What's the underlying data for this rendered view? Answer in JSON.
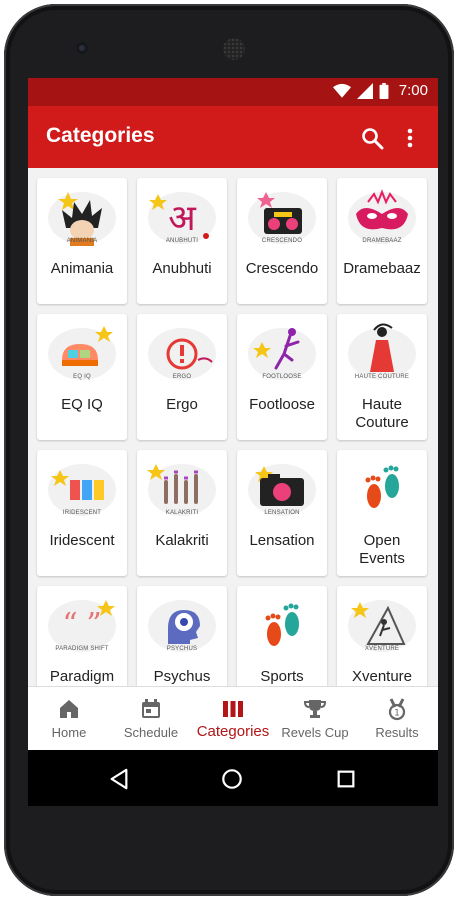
{
  "status": {
    "time": "7:00"
  },
  "appbar": {
    "title": "Categories"
  },
  "categories": [
    {
      "name": "Animania",
      "caption": "ANIMANIA"
    },
    {
      "name": "Anubhuti",
      "caption": "ANUBHUTI",
      "glyph": "अ"
    },
    {
      "name": "Crescendo",
      "caption": "CRESCENDO"
    },
    {
      "name": "Dramebaaz",
      "caption": "DRAMEBAAZ"
    },
    {
      "name": "EQ IQ",
      "caption": "EQ IQ"
    },
    {
      "name": "Ergo",
      "caption": "ERGO"
    },
    {
      "name": "Footloose",
      "caption": "FOOTLOOSE"
    },
    {
      "name": "Haute Couture",
      "caption": "HAUTE COUTURE",
      "line1": "Haute",
      "line2": "Couture"
    },
    {
      "name": "Iridescent",
      "caption": "IRIDESCENT"
    },
    {
      "name": "Kalakriti",
      "caption": "KALAKRITI"
    },
    {
      "name": "Lensation",
      "caption": "LENSATION"
    },
    {
      "name": "Open Events",
      "line1": "Open",
      "line2": "Events"
    },
    {
      "name": "Paradigm",
      "caption": "PARADIGM SHIFT"
    },
    {
      "name": "Psychus",
      "caption": "PSYCHUS"
    },
    {
      "name": "Sports"
    },
    {
      "name": "Xventure",
      "caption": "XVENTURE"
    }
  ],
  "bottom_nav": [
    {
      "label": "Home",
      "icon": "home-icon"
    },
    {
      "label": "Schedule",
      "icon": "calendar-icon"
    },
    {
      "label": "Categories",
      "icon": "categories-icon",
      "active": true
    },
    {
      "label": "Revels Cup",
      "icon": "trophy-icon"
    },
    {
      "label": "Results",
      "icon": "medal-icon"
    }
  ],
  "colors": {
    "statusbar": "#a51313",
    "appbar": "#d11a1a",
    "active_nav": "#b31616"
  }
}
